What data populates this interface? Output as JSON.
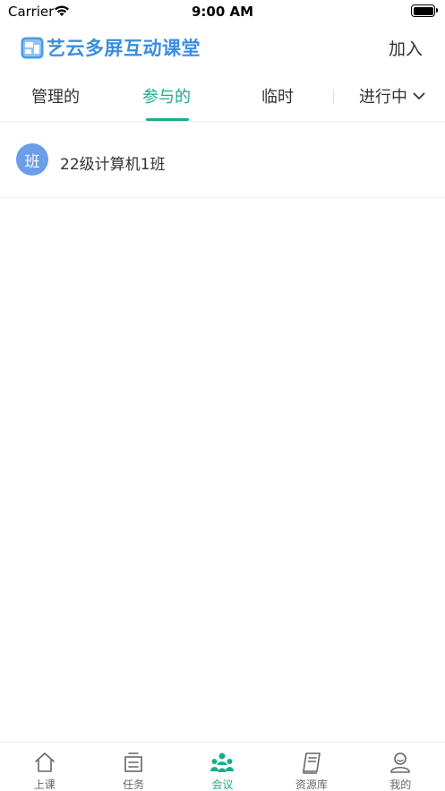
{
  "status_bar": {
    "carrier": "Carrier",
    "time": "9:00 AM"
  },
  "header": {
    "logo_text": "艺云多屏互动课堂",
    "join_label": "加入",
    "logo_color": "#3a8ee0"
  },
  "tabs": [
    {
      "label": "管理的",
      "active": false
    },
    {
      "label": "参与的",
      "active": true
    },
    {
      "label": "临时",
      "active": false
    }
  ],
  "filter": {
    "selected": "进行中"
  },
  "meetings": [
    {
      "avatar_text": "班",
      "title": "22级计算机1班"
    }
  ],
  "bottom_nav": [
    {
      "label": "上课",
      "icon": "home-icon",
      "active": false
    },
    {
      "label": "任务",
      "icon": "task-icon",
      "active": false
    },
    {
      "label": "会议",
      "icon": "meeting-icon",
      "active": true
    },
    {
      "label": "资源库",
      "icon": "library-icon",
      "active": false
    },
    {
      "label": "我的",
      "icon": "profile-icon",
      "active": false
    }
  ],
  "colors": {
    "accent": "#1aad8c",
    "avatar_bg": "#6a9eea",
    "text": "#333333"
  }
}
